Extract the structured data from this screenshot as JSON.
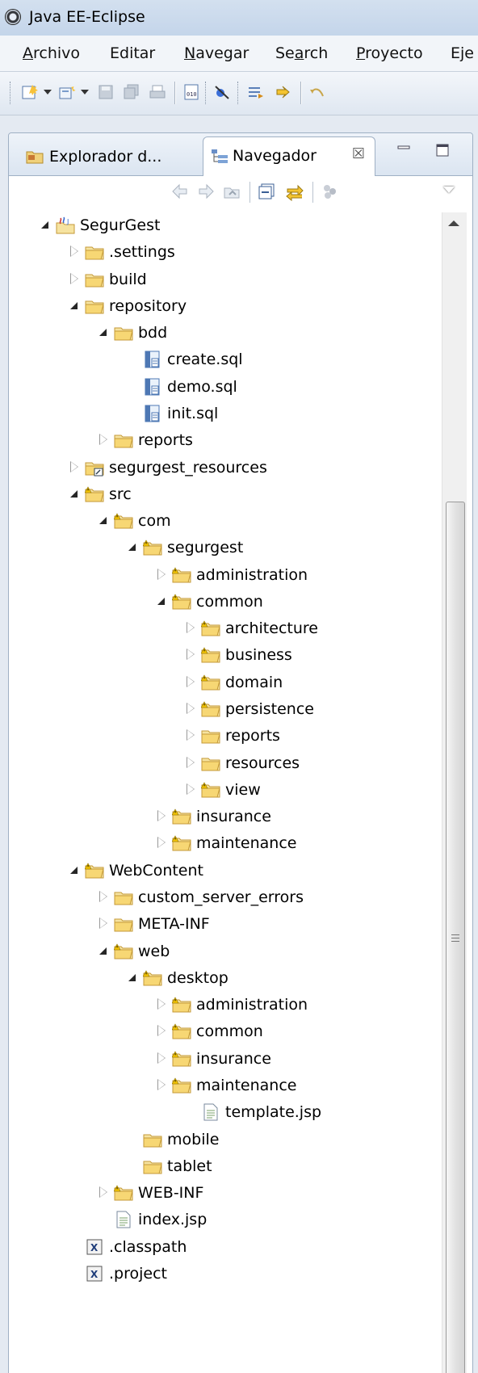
{
  "window": {
    "title": "Java EE-Eclipse"
  },
  "menu": [
    {
      "label": "Archivo",
      "mnemonic": "A",
      "rest": "rchivo"
    },
    {
      "label": "Editar",
      "mnemonic": "",
      "rest": "Editar"
    },
    {
      "label": "Navegar",
      "mnemonic": "N",
      "rest": "avegar"
    },
    {
      "label": "Search",
      "pre": "Se",
      "mnemonic": "a",
      "rest": "rch"
    },
    {
      "label": "Proyecto",
      "mnemonic": "P",
      "rest": "royecto"
    },
    {
      "label": "Eje",
      "mnemonic": "",
      "rest": "Eje"
    }
  ],
  "toolbar": {
    "icons": [
      "new-icon",
      "new-project-icon",
      "save-icon",
      "save-all-icon",
      "print-icon",
      "binary-icon",
      "skip-breakpoints-icon",
      "next-annotation-icon",
      "run-icon",
      "back-icon"
    ]
  },
  "tabs": {
    "inactive_label": "Explorador d...",
    "active_label": "Navegador",
    "close_glyph": "☒"
  },
  "tree": [
    {
      "label": "SegurGest",
      "depth": 0,
      "state": "expanded",
      "icon": "project-icon"
    },
    {
      "label": ".settings",
      "depth": 1,
      "state": "collapsed",
      "icon": "folder-icon"
    },
    {
      "label": "build",
      "depth": 1,
      "state": "collapsed",
      "icon": "folder-icon"
    },
    {
      "label": "repository",
      "depth": 1,
      "state": "expanded",
      "icon": "folder-icon"
    },
    {
      "label": "bdd",
      "depth": 2,
      "state": "expanded",
      "icon": "folder-icon"
    },
    {
      "label": "create.sql",
      "depth": 3,
      "state": "none",
      "icon": "sql-file-icon"
    },
    {
      "label": "demo.sql",
      "depth": 3,
      "state": "none",
      "icon": "sql-file-icon"
    },
    {
      "label": "init.sql",
      "depth": 3,
      "state": "none",
      "icon": "sql-file-icon"
    },
    {
      "label": "reports",
      "depth": 2,
      "state": "collapsed",
      "icon": "folder-icon"
    },
    {
      "label": "segurgest_resources",
      "depth": 1,
      "state": "collapsed",
      "icon": "linked-folder-icon"
    },
    {
      "label": "src",
      "depth": 1,
      "state": "expanded",
      "icon": "warning-folder-icon"
    },
    {
      "label": "com",
      "depth": 2,
      "state": "expanded",
      "icon": "warning-folder-icon"
    },
    {
      "label": "segurgest",
      "depth": 3,
      "state": "expanded",
      "icon": "warning-folder-icon"
    },
    {
      "label": "administration",
      "depth": 4,
      "state": "collapsed",
      "icon": "warning-folder-icon"
    },
    {
      "label": "common",
      "depth": 4,
      "state": "expanded",
      "icon": "warning-folder-icon"
    },
    {
      "label": "architecture",
      "depth": 5,
      "state": "collapsed",
      "icon": "warning-folder-icon"
    },
    {
      "label": "business",
      "depth": 5,
      "state": "collapsed",
      "icon": "warning-folder-icon"
    },
    {
      "label": "domain",
      "depth": 5,
      "state": "collapsed",
      "icon": "warning-folder-icon"
    },
    {
      "label": "persistence",
      "depth": 5,
      "state": "collapsed",
      "icon": "warning-folder-icon"
    },
    {
      "label": "reports",
      "depth": 5,
      "state": "collapsed",
      "icon": "folder-icon"
    },
    {
      "label": "resources",
      "depth": 5,
      "state": "collapsed",
      "icon": "folder-icon"
    },
    {
      "label": "view",
      "depth": 5,
      "state": "collapsed",
      "icon": "warning-folder-icon"
    },
    {
      "label": "insurance",
      "depth": 4,
      "state": "collapsed",
      "icon": "warning-folder-icon"
    },
    {
      "label": "maintenance",
      "depth": 4,
      "state": "collapsed",
      "icon": "warning-folder-icon"
    },
    {
      "label": "WebContent",
      "depth": 1,
      "state": "expanded",
      "icon": "warning-folder-icon"
    },
    {
      "label": "custom_server_errors",
      "depth": 2,
      "state": "collapsed",
      "icon": "folder-icon"
    },
    {
      "label": "META-INF",
      "depth": 2,
      "state": "collapsed",
      "icon": "folder-icon"
    },
    {
      "label": "web",
      "depth": 2,
      "state": "expanded",
      "icon": "warning-folder-icon"
    },
    {
      "label": "desktop",
      "depth": 3,
      "state": "expanded",
      "icon": "warning-folder-icon"
    },
    {
      "label": "administration",
      "depth": 4,
      "state": "collapsed",
      "icon": "warning-folder-icon"
    },
    {
      "label": "common",
      "depth": 4,
      "state": "collapsed",
      "icon": "warning-folder-icon"
    },
    {
      "label": "insurance",
      "depth": 4,
      "state": "collapsed",
      "icon": "warning-folder-icon"
    },
    {
      "label": "maintenance",
      "depth": 4,
      "state": "collapsed",
      "icon": "warning-folder-icon"
    },
    {
      "label": "template.jsp",
      "depth": 5,
      "state": "none",
      "icon": "jsp-file-icon"
    },
    {
      "label": "mobile",
      "depth": 3,
      "state": "none",
      "icon": "folder-icon"
    },
    {
      "label": "tablet",
      "depth": 3,
      "state": "none",
      "icon": "folder-icon"
    },
    {
      "label": "WEB-INF",
      "depth": 2,
      "state": "collapsed",
      "icon": "warning-folder-icon"
    },
    {
      "label": "index.jsp",
      "depth": 2,
      "state": "none",
      "icon": "jsp-file-icon"
    },
    {
      "label": ".classpath",
      "depth": 1,
      "state": "none",
      "icon": "xml-file-icon"
    },
    {
      "label": ".project",
      "depth": 1,
      "state": "none",
      "icon": "xml-file-icon"
    }
  ]
}
